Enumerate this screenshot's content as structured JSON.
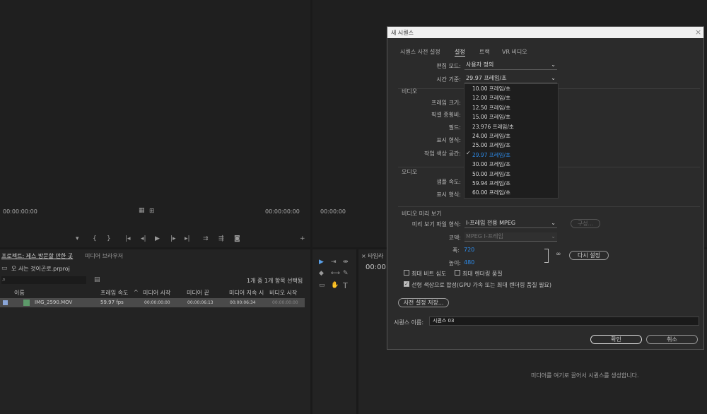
{
  "monitors": {
    "source_tc_left": "00:00:00:00",
    "source_tc_right": "00:00:00:00",
    "program_tc_left": "00:00:00"
  },
  "project": {
    "tab_active": "프로젝트: 제스 방문할 만한 곳",
    "tab_other": "미디어 브라우저",
    "filename": "오 서는 것이곤로.prproj",
    "count_text": "1개 중 1개 항목 선택됨",
    "columns": [
      "이름",
      "프레임 속도",
      "미디어 시작",
      "미디어 끝",
      "미디어 지속 시",
      "비디오 시작"
    ],
    "rows": [
      {
        "name": "IMG_2590.MOV",
        "fps": "59.97 fps",
        "start": "00:00:00:00",
        "end": "00:00:06:13",
        "duration": "00:00:06:34",
        "vstart": "00:00:00:00"
      }
    ]
  },
  "timeline": {
    "tab": "타임라",
    "tc": "00:00",
    "empty_hint": "미디어를 여기로 끌어서 시퀀스를 생성합니다."
  },
  "dialog": {
    "title": "새 시퀀스",
    "tabs": [
      "시퀀스 사전 설정",
      "설정",
      "트랙",
      "VR 비디오"
    ],
    "edit_mode_label": "편집 모드:",
    "edit_mode_value": "사용자 정의",
    "timebase_label": "시간 기준:",
    "timebase_value": "29.97 프레임/초",
    "video_section": "비디오",
    "frame_size_label": "프레임 크기:",
    "pixel_ratio_label": "픽셀 종횡비:",
    "fields_label": "필드:",
    "display_format_label": "표시 형식:",
    "working_color_label": "작업 색상 공간:",
    "audio_section": "오디오",
    "sample_rate_label": "샘플 속도:",
    "audio_display_label": "표시 형식:",
    "preview_section": "비디오 미리 보기",
    "preview_format_label": "미리 보기 파일 형식:",
    "preview_format_value": "I-프레임 전용 MPEG",
    "configure_label": "구성...",
    "codec_label": "코덱:",
    "codec_value": "MPEG I-프레임",
    "width_label": "폭:",
    "width_value": "720",
    "height_label": "높이:",
    "height_value": "480",
    "reset_label": "다시 설정",
    "max_bit_label": "최대 비트 심도",
    "max_render_label": "최대 렌더링 품질",
    "linear_color_label": "선형 색상으로 합성(GPU 가속 또는 최대 렌더링 품질 필요)",
    "save_preset_label": "사전 설정 저장...",
    "seq_name_label": "시퀀스 이름:",
    "seq_name_value": "시퀀스 03",
    "ok_label": "확인",
    "cancel_label": "취소",
    "frame_rates": [
      "10.00 프레임/초",
      "12.00 프레임/초",
      "12.50 프레임/초",
      "15.00 프레임/초",
      "23.976 프레임/초",
      "24.00 프레임/초",
      "25.00 프레임/초",
      "29.97 프레임/초",
      "30.00 프레임/초",
      "50.00 프레임/초",
      "59.94 프레임/초",
      "60.00 프레임/초"
    ],
    "selected_index": 7
  }
}
